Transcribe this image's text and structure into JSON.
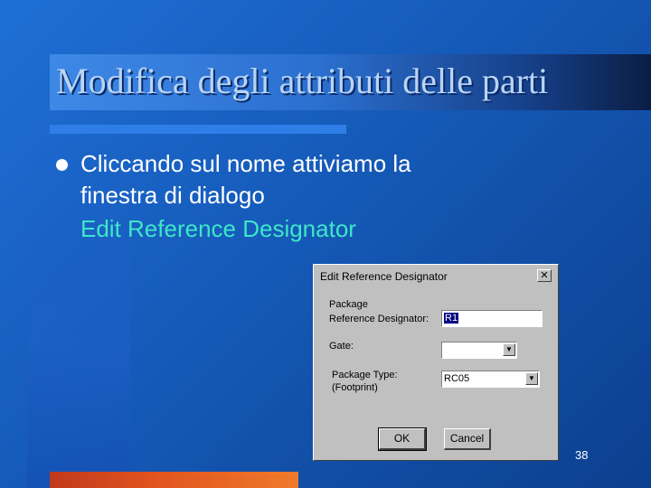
{
  "slide": {
    "title": "Modifica degli attributi delle parti",
    "bullet_line1": "Cliccando sul nome attiviamo la",
    "bullet_line2": "finestra di dialogo",
    "bullet_line3": "Edit Reference Designator",
    "page_number": "38"
  },
  "dialog": {
    "title": "Edit Reference Designator",
    "close_glyph": "✕",
    "package_label": "Package",
    "refdes_label": "Reference Designator:",
    "refdes_value": "R1",
    "gate_label": "Gate:",
    "gate_value": "",
    "package_type_label": "Package Type:",
    "footprint_label": "(Footprint)",
    "package_type_value": "RC05",
    "dropdown_glyph": "▼",
    "ok_label": "OK",
    "cancel_label": "Cancel"
  }
}
